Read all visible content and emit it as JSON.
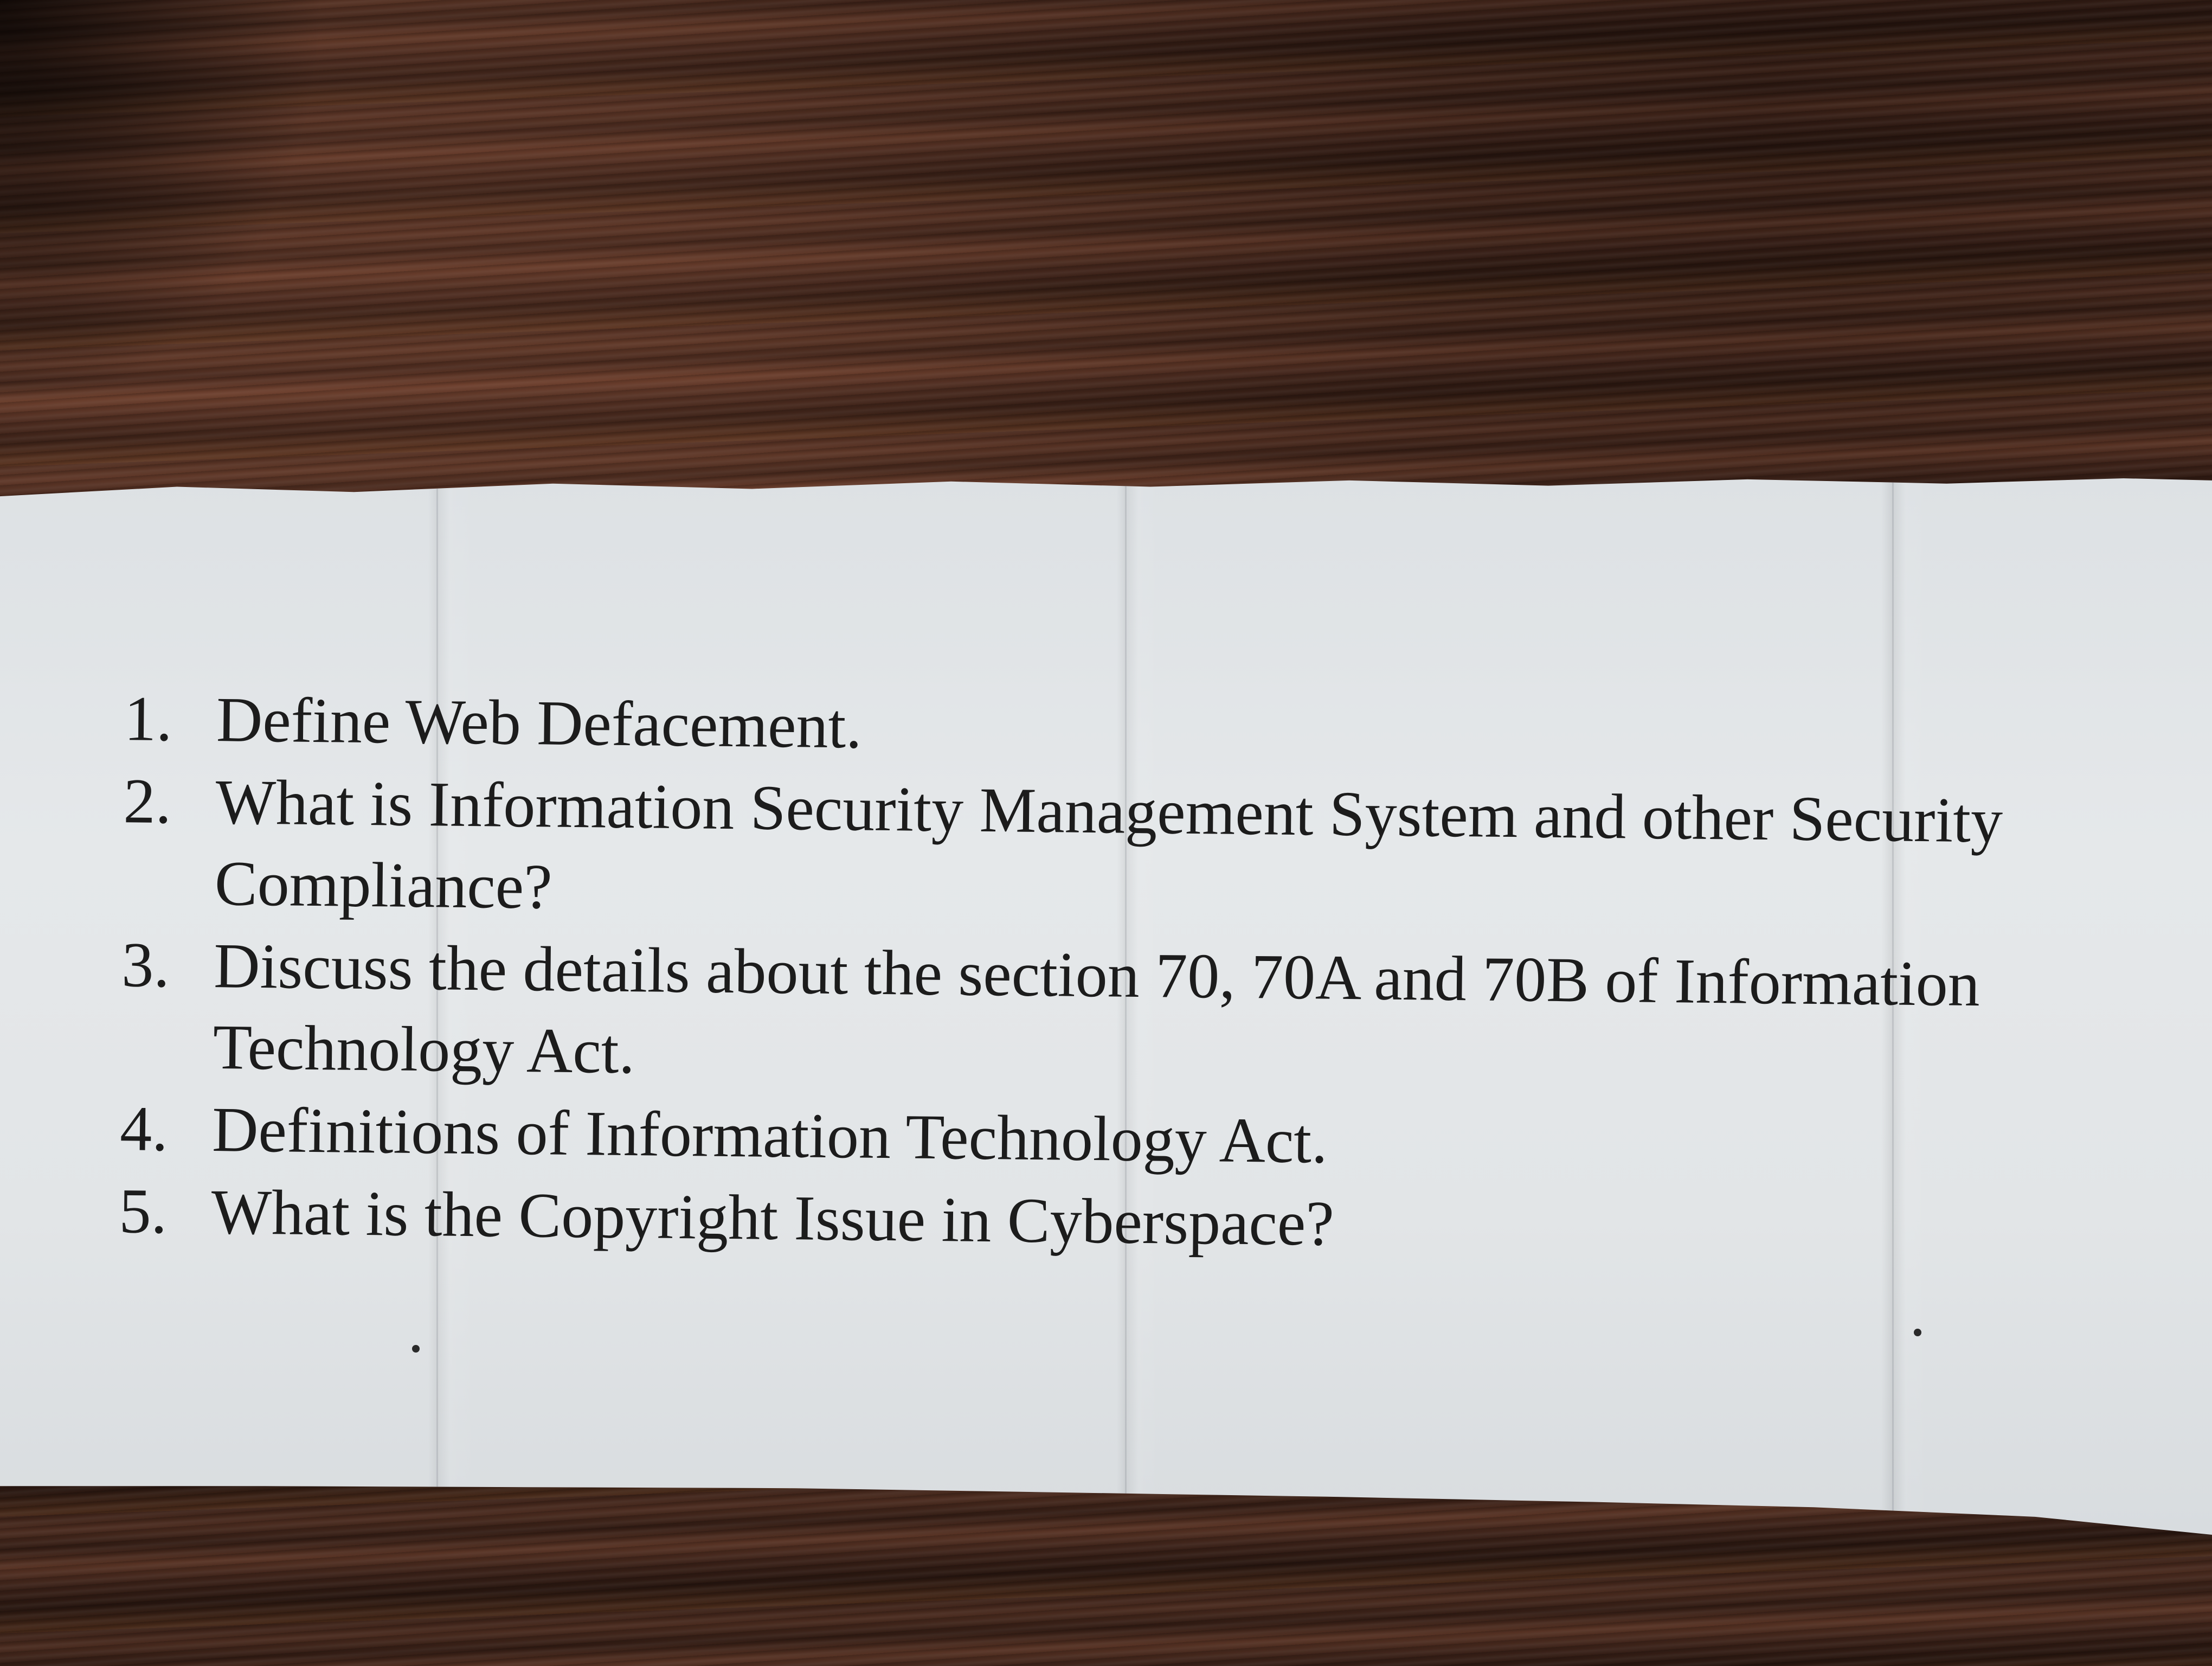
{
  "questions": [
    {
      "number": "1.",
      "text": "Define Web Defacement."
    },
    {
      "number": "2.",
      "text": "What is Information Security Management System and other Security Compliance?"
    },
    {
      "number": "3.",
      "text": "Discuss the details about the section 70, 70A and 70B of Information Technology Act."
    },
    {
      "number": "4.",
      "text": "Definitions of Information Technology Act."
    },
    {
      "number": "5.",
      "text": "What is the Copyright Issue in Cyberspace?"
    }
  ],
  "colors": {
    "paper": "#e3e6e8",
    "ink": "#1c1c1c",
    "table_wood": "#4a2a1e"
  }
}
